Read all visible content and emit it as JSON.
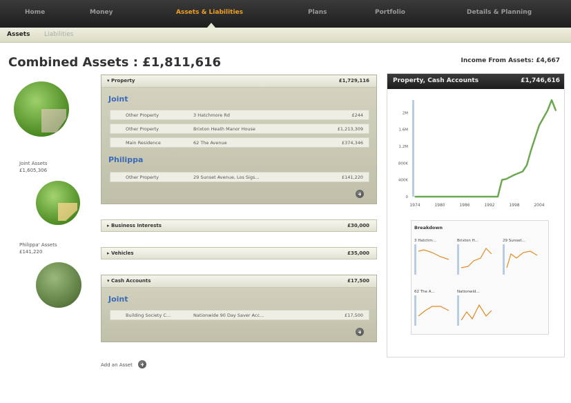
{
  "nav": {
    "items": [
      "Home",
      "Money",
      "Assets & Liabilities",
      "Plans",
      "Portfolio",
      "Details & Planning"
    ],
    "active": "Assets & Liabilities"
  },
  "subnav": {
    "assets": "Assets",
    "liabilities": "Liabilities"
  },
  "header": {
    "combined": "Combined Assets : £1,811,616",
    "income": "Income From Assets: £4,667"
  },
  "left": {
    "joint_label": "Joint Assets",
    "joint_value": "£1,605,306",
    "phil_label": "Philippa' Assets",
    "phil_value": "£141,220"
  },
  "property": {
    "title": "Property",
    "amount": "£1,729,116",
    "joint_title": "Joint",
    "joint_rows": [
      [
        "Other Property",
        "3 Hatchmore Rd",
        "£244"
      ],
      [
        "Other Property",
        "Brixton Heath Manor House",
        "£1,213,309"
      ],
      [
        "Main Residence",
        "62 The Avenue",
        "£374,346"
      ]
    ],
    "phil_title": "Philippa",
    "phil_rows": [
      [
        "Other Property",
        "29 Sunset Avenue, Los Sigs...",
        "£141,220"
      ]
    ]
  },
  "business": {
    "title": "Business Interests",
    "amount": "£30,000"
  },
  "vehicles": {
    "title": "Vehicles",
    "amount": "£35,000"
  },
  "cash": {
    "title": "Cash Accounts",
    "amount": "£17,500",
    "joint_title": "Joint",
    "rows": [
      [
        "Building Society C...",
        "Nationwide 90 Day Saver Acc...",
        "£17,500"
      ]
    ]
  },
  "add_asset": "Add an Asset",
  "chart": {
    "title": "Property, Cash Accounts",
    "amount": "£1,746,616",
    "breakdown_title": "Breakdown",
    "spark_labels": [
      "3 Hatchm...",
      "Brixton H...",
      "29 Sunset...",
      "62 The A...",
      "Nationwid..."
    ]
  },
  "chart_data": {
    "type": "line",
    "x": [
      1974,
      1978,
      1982,
      1986,
      1990,
      1994,
      1995,
      1996,
      1998,
      2000,
      2001,
      2002,
      2004,
      2006,
      2007,
      2008
    ],
    "y": [
      0,
      0,
      0,
      0,
      0,
      0,
      400000,
      420000,
      520000,
      600000,
      750000,
      1100000,
      1700000,
      2050000,
      2300000,
      2050000
    ],
    "xticks": [
      "1974",
      "1980",
      "1986",
      "1992",
      "1998",
      "2004"
    ],
    "yticks": [
      "0",
      "400K",
      "800K",
      "1.2M",
      "1.6M",
      "2M"
    ],
    "ylim": [
      0,
      2300000
    ],
    "color": "#6aa84f"
  },
  "colors": {
    "accent": "#f0a020",
    "link": "#3a6ab8",
    "line": "#6aa84f"
  }
}
